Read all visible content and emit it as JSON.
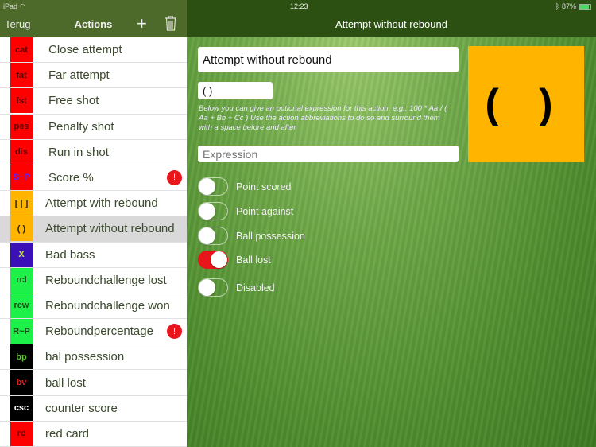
{
  "status": {
    "device": "iPad",
    "time": "12:23",
    "battery": "87%",
    "battery_level": 0.87
  },
  "nav": {
    "back": "Terug",
    "title": "Actions",
    "detail_title": "Attempt without rebound"
  },
  "actions": [
    {
      "abbr": "cat",
      "label": "Close attempt",
      "bg": "#ff0000",
      "fg": "#5a0000",
      "warn": false
    },
    {
      "abbr": "fat",
      "label": "Far attempt",
      "bg": "#ff0000",
      "fg": "#5a0000",
      "warn": false
    },
    {
      "abbr": "fst",
      "label": "Free shot",
      "bg": "#ff0000",
      "fg": "#5a0000",
      "warn": false
    },
    {
      "abbr": "pes",
      "label": "Penalty shot",
      "bg": "#ff0000",
      "fg": "#5a0000",
      "warn": false
    },
    {
      "abbr": "dis",
      "label": "Run in shot",
      "bg": "#ff0000",
      "fg": "#5a0000",
      "warn": false
    },
    {
      "abbr": "S~P",
      "label": "Score %",
      "bg": "#ff0000",
      "fg": "#5a22ff",
      "warn": true
    },
    {
      "abbr": "[ | ]",
      "label": "Attempt with rebound",
      "bg": "#ffb400",
      "fg": "#222",
      "warn": false
    },
    {
      "abbr": "( )",
      "label": "Attempt without rebound",
      "bg": "#ffb400",
      "fg": "#222",
      "warn": false,
      "selected": true
    },
    {
      "abbr": "X",
      "label": "Bad bass",
      "bg": "#3b10b8",
      "fg": "#c8e84a",
      "warn": false
    },
    {
      "abbr": "rcl",
      "label": "Reboundchallenge lost",
      "bg": "#1ef04a",
      "fg": "#1a4a1a",
      "warn": false
    },
    {
      "abbr": "rcw",
      "label": "Reboundchallenge won",
      "bg": "#1ef04a",
      "fg": "#1a4a1a",
      "warn": false
    },
    {
      "abbr": "R~P",
      "label": "Reboundpercentage",
      "bg": "#1ef04a",
      "fg": "#1a4a1a",
      "warn": true
    },
    {
      "abbr": "bp",
      "label": "bal possession",
      "bg": "#000000",
      "fg": "#5ec832",
      "warn": false
    },
    {
      "abbr": "bv",
      "label": "ball lost",
      "bg": "#000000",
      "fg": "#d8221b",
      "warn": false
    },
    {
      "abbr": "csc",
      "label": "counter score",
      "bg": "#000000",
      "fg": "#ffffff",
      "warn": false
    },
    {
      "abbr": "rc",
      "label": "red card",
      "bg": "#ff0000",
      "fg": "#5a0000",
      "warn": false
    }
  ],
  "warn_glyph": "!",
  "detail": {
    "name": "Attempt without rebound",
    "abbr": "( )",
    "help": "Below you can give an optional expression for this action, e.g.: 100 * Aa / ( Aa + Bb + Cc ) Use the action abbreviations to do so and surround them with a space before and after",
    "expression_placeholder": "Expression",
    "expression": "",
    "color": "#ffb400",
    "toggles": [
      {
        "label": "Point scored",
        "on": false
      },
      {
        "label": "Point against",
        "on": false
      },
      {
        "label": "Ball possession",
        "on": false
      },
      {
        "label": "Ball lost",
        "on": true
      },
      {
        "label": "Disabled",
        "on": false
      }
    ]
  }
}
